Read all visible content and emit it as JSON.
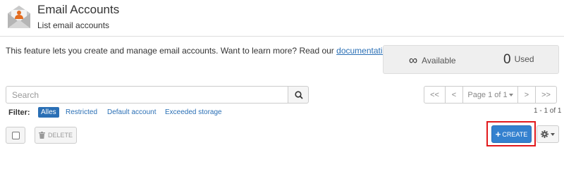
{
  "header": {
    "title": "Email Accounts",
    "subtitle": "List email accounts"
  },
  "description": {
    "text": "This feature lets you create and manage email accounts. Want to learn more? Read our",
    "link_label": "documentation",
    "suffix": "."
  },
  "stats": {
    "available_symbol": "∞",
    "available_label": "Available",
    "used_count": "0",
    "used_label": "Used"
  },
  "search": {
    "placeholder": "Search"
  },
  "pagination": {
    "first": "<<",
    "prev": "<",
    "page_label": "Page 1 of 1",
    "next": ">",
    "last": ">>",
    "count_label": "1 - 1 of 1"
  },
  "filter": {
    "label": "Filter:",
    "options": [
      "Alles",
      "Restricted",
      "Default account",
      "Exceeded storage"
    ]
  },
  "actions": {
    "delete_label": "DELETE",
    "create_label": "CREATE"
  },
  "colors": {
    "accent": "#3481cf",
    "highlight": "#e2191c",
    "icon_orange": "#e36c1f"
  }
}
